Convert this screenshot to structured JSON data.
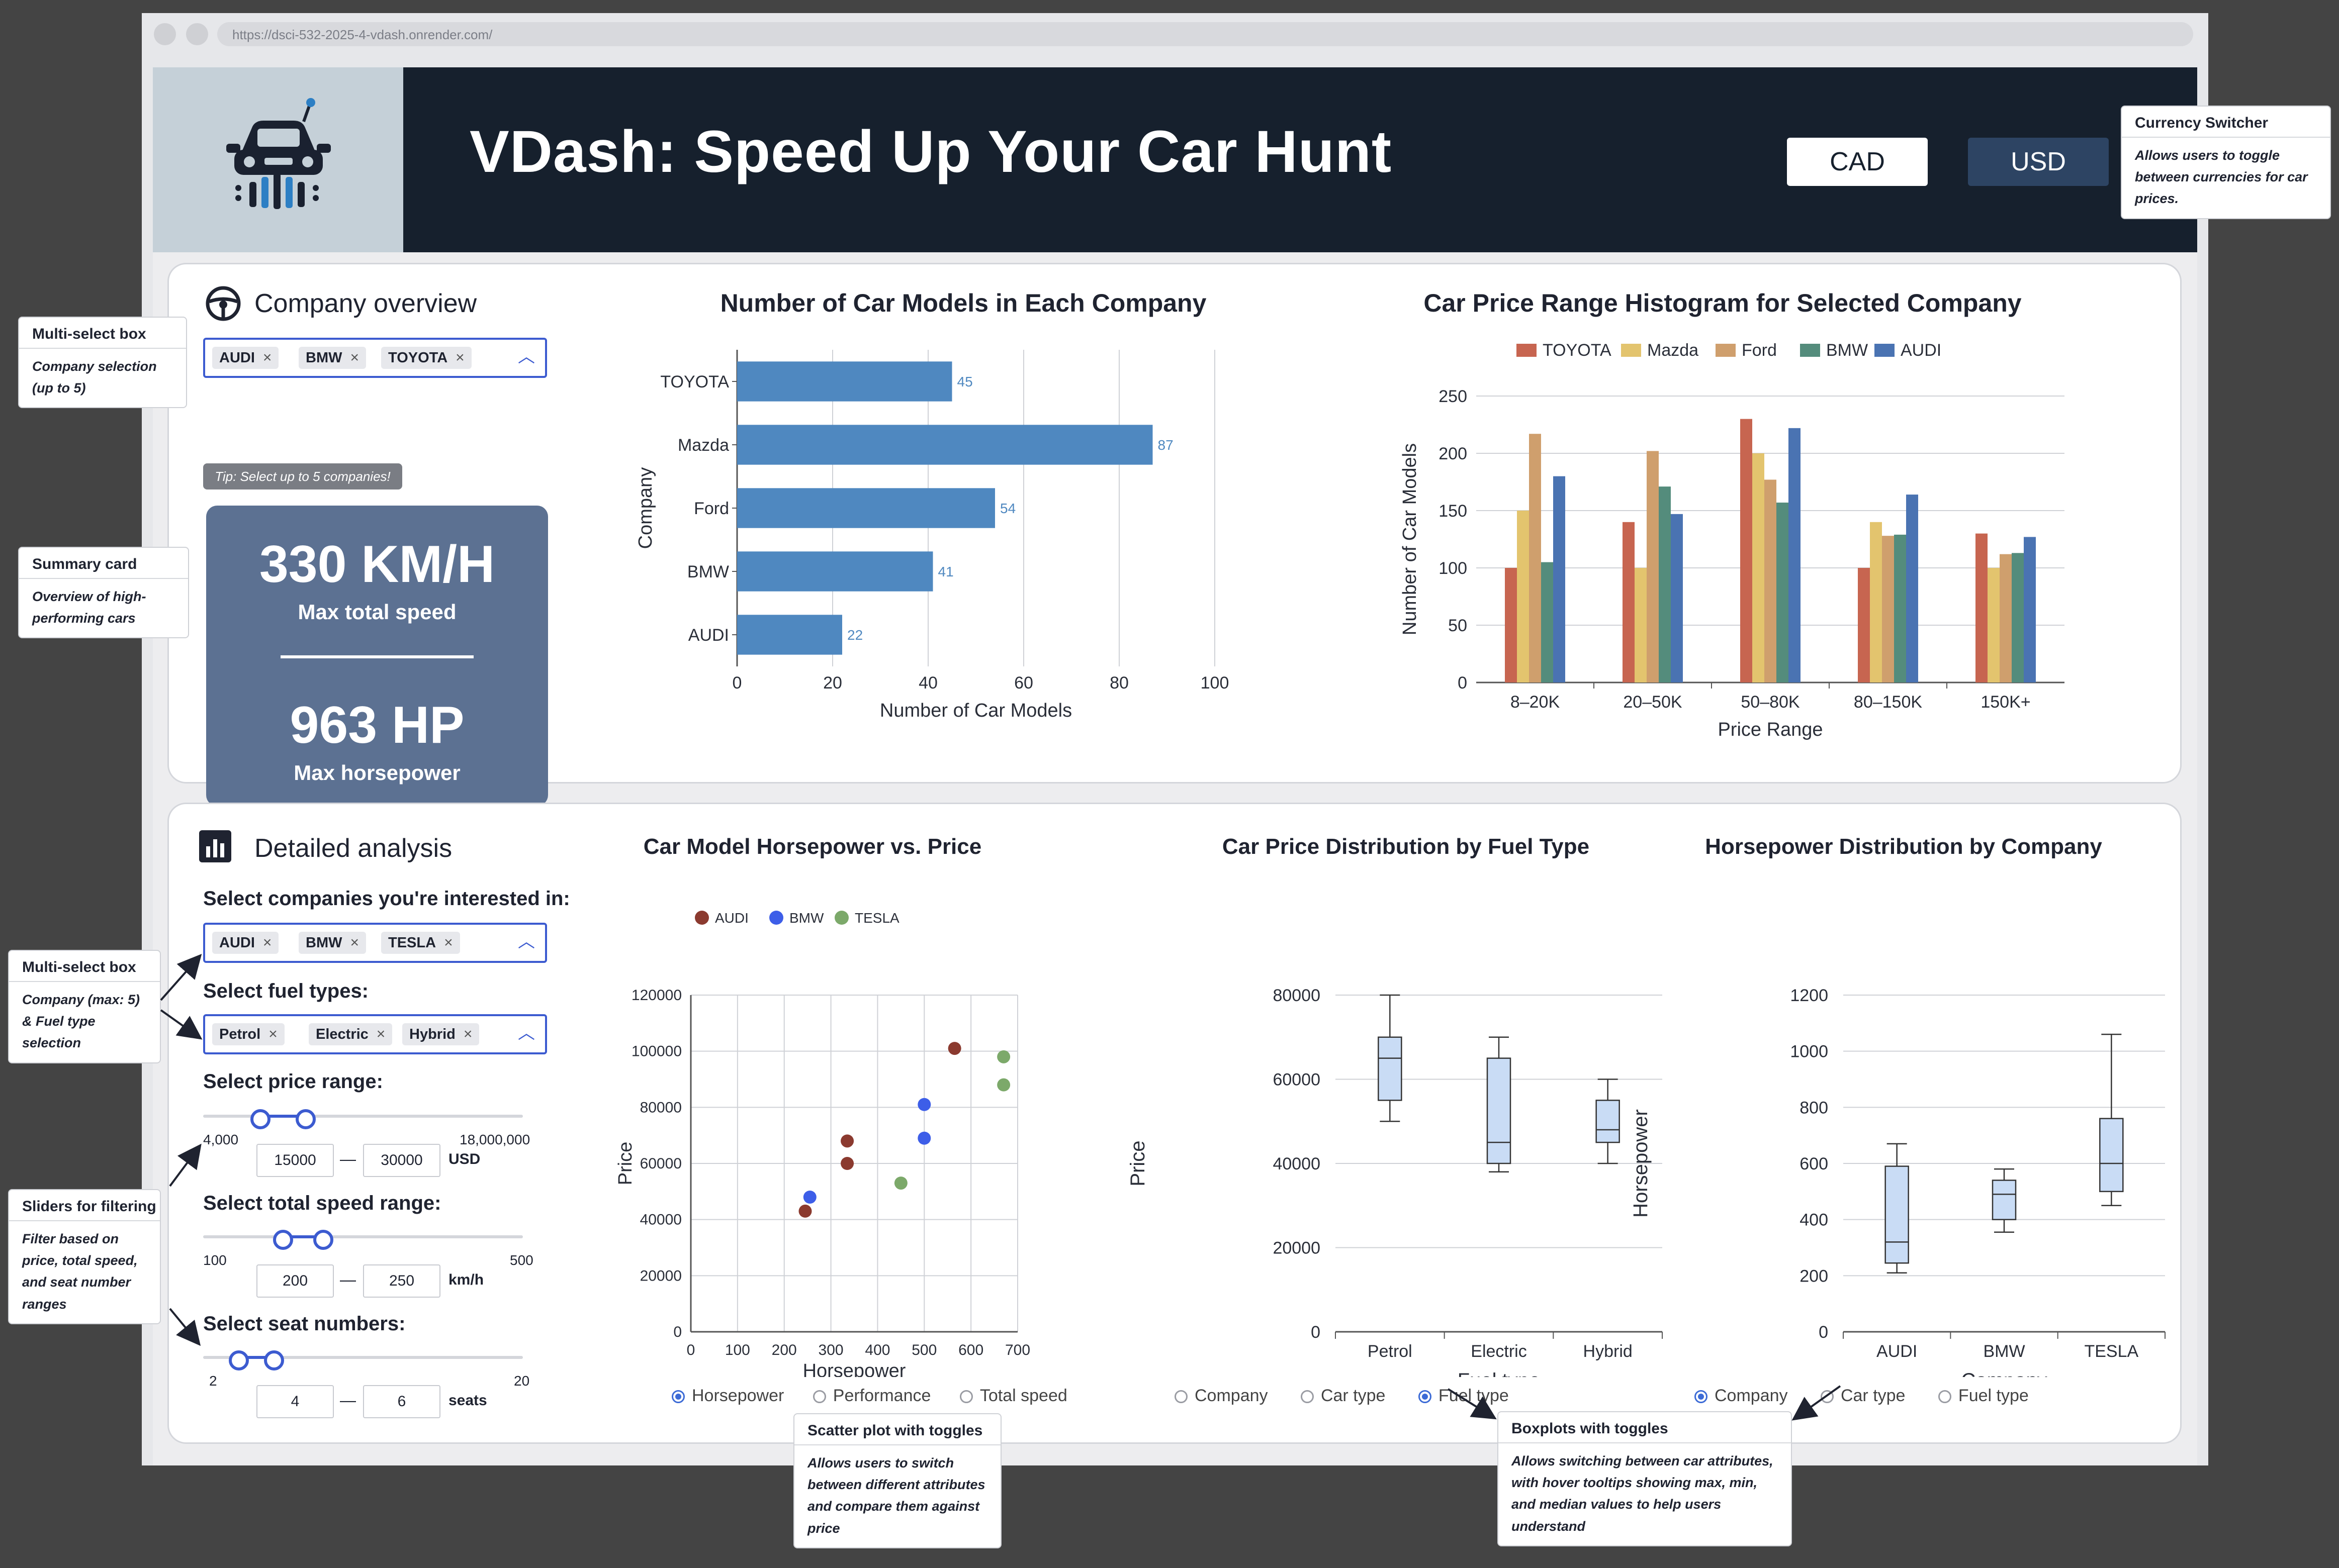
{
  "browser": {
    "url": "https://dsci-532-2025-4-vdash.onrender.com/"
  },
  "header": {
    "title": "VDash: Speed Up Your Car Hunt",
    "currency_options": [
      "CAD",
      "USD"
    ],
    "selected_currency": "USD"
  },
  "overview": {
    "section_title": "Company overview",
    "selected_companies": [
      "AUDI",
      "BMW",
      "TOYOTA"
    ],
    "tip": "Tip: Select up to 5 companies!",
    "summary": {
      "speed_value": "330 KM/H",
      "speed_label": "Max total speed",
      "hp_value": "963 HP",
      "hp_label": "Max horsepower"
    }
  },
  "analysis": {
    "section_title": "Detailed analysis",
    "companies_label": "Select companies you're interested in:",
    "selected_companies": [
      "AUDI",
      "BMW",
      "TESLA"
    ],
    "fuel_label": "Select fuel types:",
    "selected_fuels": [
      "Petrol",
      "Electric",
      "Hybrid"
    ],
    "price": {
      "label": "Select price range:",
      "min": 4000,
      "max": 18000000,
      "min_text": "4,000",
      "max_text": "18,000,000",
      "low": "15000",
      "high": "30000",
      "unit": "USD",
      "low_frac": 0.18,
      "high_frac": 0.32
    },
    "speed": {
      "label": "Select total speed range:",
      "min": 100,
      "max": 500,
      "min_text": "100",
      "max_text": "500",
      "low": "200",
      "high": "250",
      "unit": "km/h",
      "low_frac": 0.25,
      "high_frac": 0.375
    },
    "seats": {
      "label": "Select seat numbers:",
      "min": 2,
      "max": 20,
      "min_text": "2",
      "max_text": "20",
      "low": "4",
      "high": "6",
      "unit": "seats",
      "low_frac": 0.111,
      "high_frac": 0.222
    },
    "scatter_toggles": [
      "Horsepower",
      "Performance",
      "Total speed"
    ],
    "scatter_selected": 0,
    "fuelbox_toggles": [
      "Company",
      "Car type",
      "Fuel type"
    ],
    "fuelbox_selected": 2,
    "hpbox_toggles": [
      "Company",
      "Car type",
      "Fuel type"
    ],
    "hpbox_selected": 0
  },
  "annotations": {
    "currency": {
      "title": "Currency Switcher",
      "text": "Allows users to toggle between currencies for car prices."
    },
    "multiselect1": {
      "title": "Multi-select box",
      "text": "Company selection (up to 5)"
    },
    "summary": {
      "title": "Summary card",
      "text": "Overview of high-performing cars"
    },
    "multiselect2": {
      "title": "Multi-select box",
      "text": "Company (max: 5) & Fuel type selection"
    },
    "sliders": {
      "title": "Sliders for filtering",
      "text": "Filter based on price, total speed, and seat number ranges"
    },
    "scatter": {
      "title": "Scatter plot with toggles",
      "text": "Allows users to switch between different attributes and compare them against price"
    },
    "boxplots": {
      "title": "Boxplots with toggles",
      "text": "Allows switching between car attributes, with hover tooltips showing max, min, and median values to help users understand"
    }
  },
  "colors": {
    "header_bg": "#16202d",
    "accent": "#3c5bd0",
    "bar": "#4f88c0",
    "summary_bg": "#5c7192"
  },
  "chart_data": [
    {
      "id": "models",
      "type": "bar",
      "orientation": "horizontal",
      "title": "Number of Car Models in Each Company",
      "categories": [
        "TOYOTA",
        "Mazda",
        "Ford",
        "BMW",
        "AUDI"
      ],
      "values": [
        45,
        87,
        54,
        41,
        22
      ],
      "xlabel": "Number of Car Models",
      "ylabel": "Company",
      "xlim": [
        0,
        100
      ],
      "xticks": [
        0,
        20,
        40,
        60,
        80,
        100
      ]
    },
    {
      "id": "price_hist",
      "type": "bar",
      "title": "Car Price Range Histogram for Selected Company",
      "categories": [
        "8–20K",
        "20–50K",
        "50–80K",
        "80–150K",
        "150K+"
      ],
      "series": [
        {
          "name": "TOYOTA",
          "color": "#c76550",
          "values": [
            100,
            140,
            230,
            100,
            130
          ]
        },
        {
          "name": "Mazda",
          "color": "#e3c46e",
          "values": [
            150,
            100,
            200,
            140,
            100
          ]
        },
        {
          "name": "Ford",
          "color": "#cf9f6d",
          "values": [
            217,
            202,
            177,
            128,
            112
          ]
        },
        {
          "name": "BMW",
          "color": "#548c7c",
          "values": [
            105,
            171,
            157,
            129,
            113
          ]
        },
        {
          "name": "AUDI",
          "color": "#4a73b2",
          "values": [
            180,
            147,
            222,
            164,
            127
          ]
        }
      ],
      "xlabel": "Price Range",
      "ylabel": "Number of Car Models",
      "ylim": [
        0,
        250
      ],
      "yticks": [
        0,
        50,
        100,
        150,
        200,
        250
      ],
      "legend": "top"
    },
    {
      "id": "scatter",
      "type": "scatter",
      "title": "Car Model Horsepower vs. Price",
      "series": [
        {
          "name": "AUDI",
          "color": "#8b3a2f",
          "points": [
            [
              245,
              43000
            ],
            [
              335,
              68000
            ],
            [
              335,
              60000
            ],
            [
              565,
              101000
            ]
          ]
        },
        {
          "name": "BMW",
          "color": "#3d5ee8",
          "points": [
            [
              255,
              48000
            ],
            [
              500,
              81000
            ],
            [
              500,
              69000
            ]
          ]
        },
        {
          "name": "TESLA",
          "color": "#7ca96a",
          "points": [
            [
              450,
              53000
            ],
            [
              670,
              98000
            ],
            [
              670,
              88000
            ]
          ]
        }
      ],
      "xlabel": "Horsepower",
      "ylabel": "Price",
      "xlim": [
        0,
        700
      ],
      "ylim": [
        0,
        120000
      ],
      "xticks": [
        0,
        100,
        200,
        300,
        400,
        500,
        600,
        700
      ],
      "yticks": [
        0,
        20000,
        40000,
        60000,
        80000,
        100000,
        120000
      ],
      "legend": "top",
      "grid": true
    },
    {
      "id": "fuel_box",
      "type": "box",
      "title": "Car Price Distribution by Fuel Type",
      "categories": [
        "Petrol",
        "Electric",
        "Hybrid"
      ],
      "boxes": [
        {
          "min": 50000,
          "q1": 55000,
          "median": 65000,
          "q3": 70000,
          "max": 80000
        },
        {
          "min": 38000,
          "q1": 40000,
          "median": 45000,
          "q3": 65000,
          "max": 70000
        },
        {
          "min": 40000,
          "q1": 45000,
          "median": 48000,
          "q3": 55000,
          "max": 60000
        }
      ],
      "xlabel": "Fuel type",
      "ylabel": "Price",
      "ylim": [
        0,
        80000
      ],
      "yticks": [
        0,
        20000,
        40000,
        60000,
        80000
      ]
    },
    {
      "id": "hp_box",
      "type": "box",
      "title": "Horsepower Distribution by Company",
      "categories": [
        "AUDI",
        "BMW",
        "TESLA"
      ],
      "boxes": [
        {
          "min": 210,
          "q1": 245,
          "median": 320,
          "q3": 590,
          "max": 670
        },
        {
          "min": 355,
          "q1": 400,
          "median": 490,
          "q3": 540,
          "max": 580
        },
        {
          "min": 450,
          "q1": 500,
          "median": 600,
          "q3": 760,
          "max": 1060
        }
      ],
      "xlabel": "Company",
      "ylabel": "Horsepower",
      "ylim": [
        0,
        1200
      ],
      "yticks": [
        0,
        200,
        400,
        600,
        800,
        1000,
        1200
      ]
    }
  ]
}
